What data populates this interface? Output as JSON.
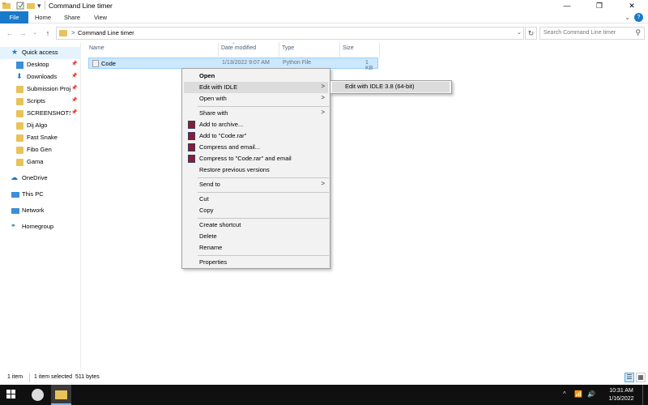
{
  "window": {
    "title": "Command Line timer",
    "controls": [
      "minimize-icon",
      "maximize-icon",
      "close-icon"
    ]
  },
  "ribbon": {
    "tabs": [
      "File",
      "Home",
      "Share",
      "View"
    ],
    "help": "?"
  },
  "address": {
    "breadcrumb_sep": ">",
    "path": "Command Line timer",
    "search_placeholder": "Search Command Line timer"
  },
  "nav": {
    "items": [
      {
        "label": "Quick access",
        "icon": "star-icon"
      },
      {
        "label": "Desktop",
        "icon": "desktop-icon",
        "pinned": true
      },
      {
        "label": "Downloads",
        "icon": "download-icon",
        "pinned": true
      },
      {
        "label": "Submission Proje",
        "icon": "folder-icon",
        "pinned": true
      },
      {
        "label": "Scripts",
        "icon": "folder-icon",
        "pinned": true
      },
      {
        "label": "SCREENSHOTS",
        "icon": "folder-icon",
        "pinned": true
      },
      {
        "label": "Dij Algo",
        "icon": "folder-icon"
      },
      {
        "label": "Fast Snake",
        "icon": "folder-icon"
      },
      {
        "label": "Fibo Gen",
        "icon": "folder-icon"
      },
      {
        "label": "Gama",
        "icon": "folder-icon"
      },
      {
        "label": "OneDrive",
        "icon": "cloud-icon"
      },
      {
        "label": "This PC",
        "icon": "computer-icon"
      },
      {
        "label": "Network",
        "icon": "network-icon"
      },
      {
        "label": "Homegroup",
        "icon": "homegroup-icon"
      }
    ]
  },
  "columns": {
    "name": "Name",
    "date_modified": "Date modified",
    "type": "Type",
    "size": "Size"
  },
  "files": [
    {
      "name": "Code",
      "date_modified": "1/13/2022 9:07 AM",
      "type": "Python File",
      "size": "1 KB"
    }
  ],
  "context_menu": {
    "items": [
      {
        "label": "Open",
        "bold": true
      },
      {
        "label": "Edit with IDLE",
        "submenu": true,
        "highlighted": true
      },
      {
        "label": "Open with",
        "submenu": true
      },
      {
        "label": "Share with",
        "submenu": true
      },
      {
        "label": "Add to archive...",
        "icon": "winrar-icon"
      },
      {
        "label": "Add to \"Code.rar\"",
        "icon": "winrar-icon"
      },
      {
        "label": "Compress and email...",
        "icon": "winrar-icon"
      },
      {
        "label": "Compress to \"Code.rar\" and email",
        "icon": "winrar-icon"
      },
      {
        "label": "Restore previous versions"
      },
      {
        "label": "Send to",
        "submenu": true
      },
      {
        "label": "Cut"
      },
      {
        "label": "Copy"
      },
      {
        "label": "Create shortcut"
      },
      {
        "label": "Delete"
      },
      {
        "label": "Rename"
      },
      {
        "label": "Properties"
      }
    ],
    "submenu_arrow": ">"
  },
  "submenu": {
    "items": [
      {
        "label": "Edit with IDLE 3.8 (64-bit)",
        "highlighted": true
      }
    ]
  },
  "status": {
    "item_count": "1 item",
    "selection": "1 item selected  511 bytes"
  },
  "taskbar": {
    "time": "10:31 AM",
    "date": "1/16/2022"
  },
  "colors": {
    "accent": "#1979ca",
    "selection": "#cce8ff",
    "folder": "#e8c25b",
    "taskbar": "#101010"
  }
}
